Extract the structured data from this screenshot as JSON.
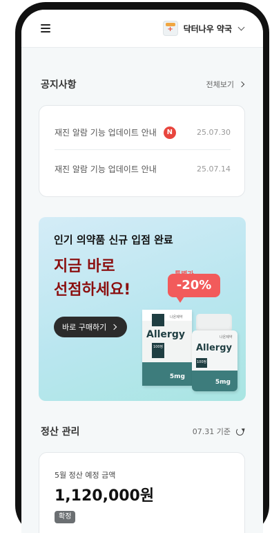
{
  "header": {
    "store_name": "닥터나우 약국",
    "menu_icon": "hamburger-menu-icon",
    "store_icon": "pharmacy-store-icon"
  },
  "notices": {
    "title": "공지사항",
    "view_all": "전체보기",
    "items": [
      {
        "text": "재진 알람 기능 업데이트 안내",
        "badge": "N",
        "date": "25.07.30"
      },
      {
        "text": "재진 알람 기능 업데이트 안내",
        "date": "25.07.14"
      }
    ]
  },
  "banner": {
    "subtitle": "인기 의약품 신규 입점 완료",
    "headline_line1": "지금 바로",
    "headline_line2": "선점하세요!",
    "button_label": "바로 구매하기",
    "discount_tag": "특별가",
    "discount_value": "-20%",
    "product": {
      "brand": "Allergy",
      "count": "100정",
      "dose": "5mg",
      "maker": "나온제약"
    }
  },
  "settlement": {
    "title": "정산 관리",
    "as_of": "07.31 기준",
    "label": "5월 정산 예정 금액",
    "amount": "1,120,000원",
    "status": "확정"
  },
  "colors": {
    "accent_red": "#8b0f0f",
    "badge_red": "#e8463e",
    "discount_red": "#f25b5b",
    "teal": "#3d7c7c"
  }
}
